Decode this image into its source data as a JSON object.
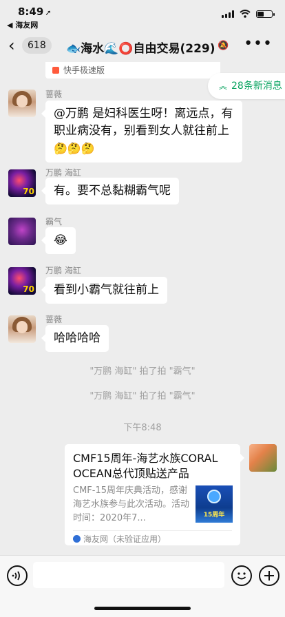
{
  "status_bar": {
    "time": "8:49",
    "back_app": "◀ 海友网"
  },
  "nav": {
    "back_icon": "chevron-left-icon",
    "unread_count": "618",
    "title": "🐟海水🌊⭕自由交易(229)",
    "more_icon": "more-dots-icon"
  },
  "banner": {
    "quoted_text": "快手极速版",
    "new_messages": "28条新消息"
  },
  "messages": [
    {
      "sender": "蔷薇",
      "text": "@万鹏 是妇科医生呀！离远点，有职业病没有，别看到女人就往前上",
      "emoji": "🤔🤔🤔"
    },
    {
      "sender": "万鹏 海缸",
      "text": "有。要不总黏糊霸气呢"
    },
    {
      "sender": "霸气",
      "text": "😂"
    },
    {
      "sender": "万鹏 海缸",
      "text": "看到小霸气就往前上"
    },
    {
      "sender": "蔷薇",
      "text": "哈哈哈哈"
    }
  ],
  "system": [
    "\"万鹏 海缸\" 拍了拍 \"霸气\"",
    "\"万鹏 海缸\" 拍了拍 \"霸气\"",
    "下午8:48"
  ],
  "card": {
    "title": "CMF15周年-海艺水族CORAL OCEAN总代顶贴送产品",
    "description": "CMF-15周年庆典活动，感谢海艺水族参与此次活动。活动时间：2020年7...",
    "thumb_text": "15周年",
    "source": "海友网（未验证应用）"
  },
  "input_bar": {
    "voice_icon": "voice-icon",
    "emoji_icon": "emoji-icon",
    "plus_icon": "plus-icon"
  }
}
